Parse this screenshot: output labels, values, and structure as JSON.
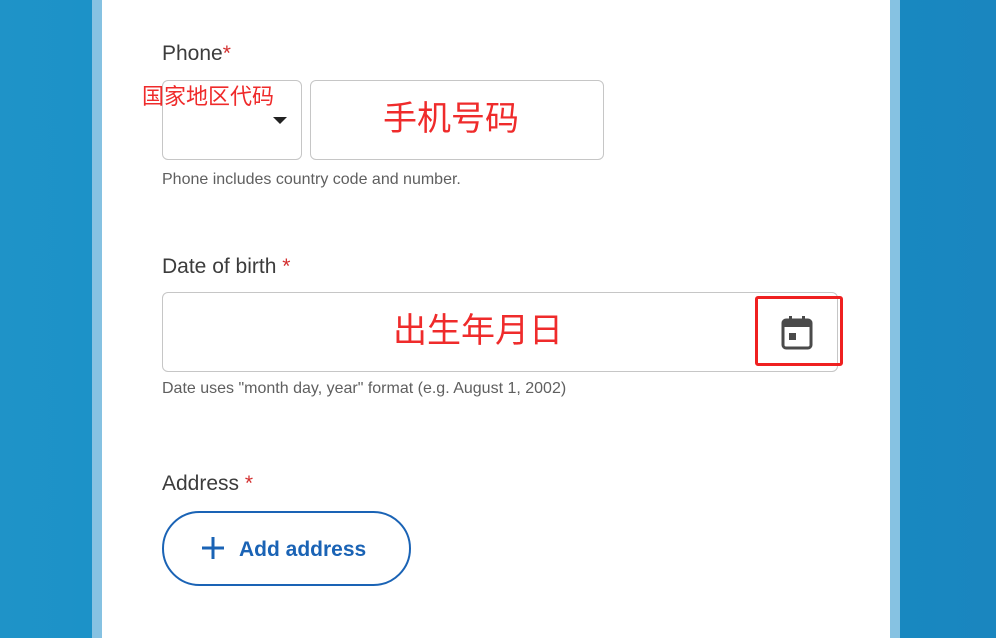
{
  "phone": {
    "label": "Phone",
    "required_mark": "*",
    "country_code_annotation": "国家地区代码",
    "number_annotation": "手机号码",
    "hint": "Phone includes country code and number."
  },
  "dob": {
    "label": "Date of birth",
    "required_mark": "*",
    "annotation": "出生年月日",
    "hint": "Date uses \"month day, year\" format (e.g. August 1, 2002)"
  },
  "address": {
    "label": "Address",
    "required_mark": "*",
    "add_button_label": "Add address"
  },
  "icons": {
    "calendar": "calendar-icon",
    "country_dropdown": "caret-down-icon",
    "add": "plus-icon"
  },
  "colors": {
    "accent": "#1a63b5",
    "required": "#d32f2f",
    "annotation": "#ef2b2b",
    "background": "#1090c6"
  }
}
